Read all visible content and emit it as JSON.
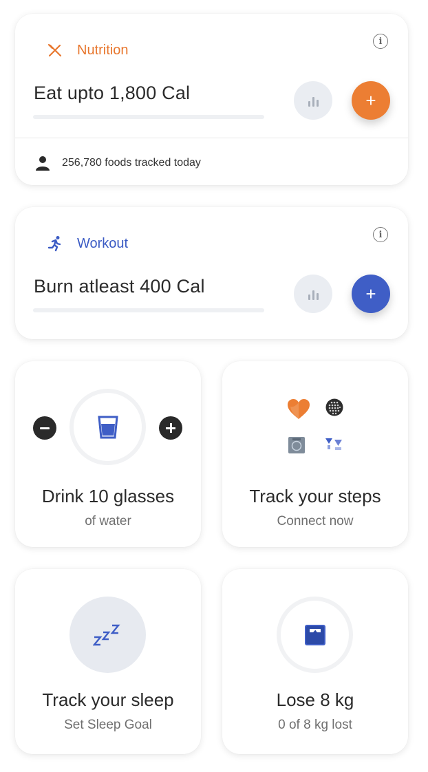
{
  "nutrition": {
    "title": "Nutrition",
    "goal": "Eat upto 1,800 Cal",
    "tracked_text": "256,780 foods tracked today",
    "accent": "#ec7e33",
    "icons": [
      "fork-knife-icon",
      "info-icon",
      "bar-chart-icon",
      "plus-icon",
      "person-icon"
    ],
    "progress": 0
  },
  "workout": {
    "title": "Workout",
    "goal": "Burn atleast 400 Cal",
    "accent": "#3f5ec6",
    "icons": [
      "running-icon",
      "info-icon",
      "bar-chart-icon",
      "plus-icon"
    ],
    "progress": 0
  },
  "water": {
    "label": "Drink 10 glasses",
    "sublabel": "of water",
    "icons": [
      "minus-icon",
      "glass-icon",
      "plus-icon"
    ]
  },
  "steps": {
    "label": "Track your steps",
    "sublabel": "Connect now",
    "icons": [
      "health-heart-icon",
      "fitbit-icon",
      "samsung-health-icon",
      "google-fit-icon"
    ]
  },
  "sleep": {
    "label": "Track your sleep",
    "sublabel": "Set Sleep Goal",
    "icons": [
      "zzz-icon"
    ]
  },
  "weight": {
    "label": "Lose 8 kg",
    "sublabel": "0 of 8 kg lost",
    "icons": [
      "weighing-scale-icon"
    ],
    "progress": 0
  }
}
